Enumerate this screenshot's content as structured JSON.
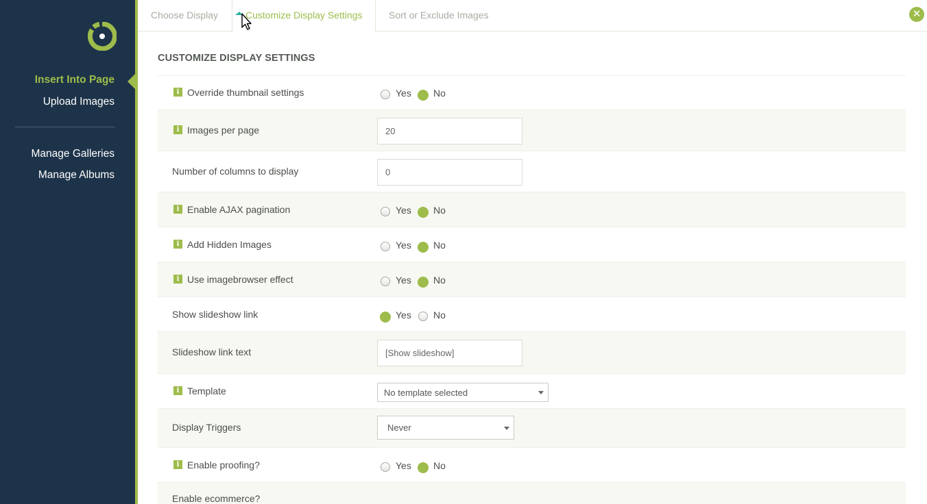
{
  "sidebar": {
    "items": [
      {
        "label": "Insert Into Page",
        "active": true
      },
      {
        "label": "Upload Images"
      },
      {
        "label": "Manage Galleries"
      },
      {
        "label": "Manage Albums"
      }
    ]
  },
  "tabs": [
    {
      "label": "Choose Display"
    },
    {
      "label": "Customize Display Settings",
      "active": true
    },
    {
      "label": "Sort or Exclude Images"
    }
  ],
  "close_glyph": "✕",
  "section_title": "CUSTOMIZE DISPLAY SETTINGS",
  "info_glyph": "i",
  "radio_labels": {
    "yes": "Yes",
    "no": "No"
  },
  "settings": {
    "override_thumbnail": {
      "label": "Override thumbnail settings",
      "value": "No"
    },
    "images_per_page": {
      "label": "Images per page",
      "value": "20"
    },
    "number_of_columns": {
      "label": "Number of columns to display",
      "value": "0"
    },
    "ajax_pagination": {
      "label": "Enable AJAX pagination",
      "value": "No"
    },
    "add_hidden_images": {
      "label": "Add Hidden Images",
      "value": "No"
    },
    "imagebrowser_effect": {
      "label": "Use imagebrowser effect",
      "value": "No"
    },
    "show_slideshow_link": {
      "label": "Show slideshow link",
      "value": "Yes"
    },
    "slideshow_link_text": {
      "label": "Slideshow link text",
      "value": "[Show slideshow]"
    },
    "template": {
      "label": "Template",
      "value": "No template selected"
    },
    "display_triggers": {
      "label": "Display Triggers",
      "value": "Never"
    },
    "enable_proofing": {
      "label": "Enable proofing?",
      "value": "No"
    },
    "enable_ecommerce": {
      "label": "Enable ecommerce?"
    }
  },
  "colors": {
    "sidebar_bg": "#1d3349",
    "accent": "#9ebc4b",
    "row_alt": "#f6f8f1"
  }
}
